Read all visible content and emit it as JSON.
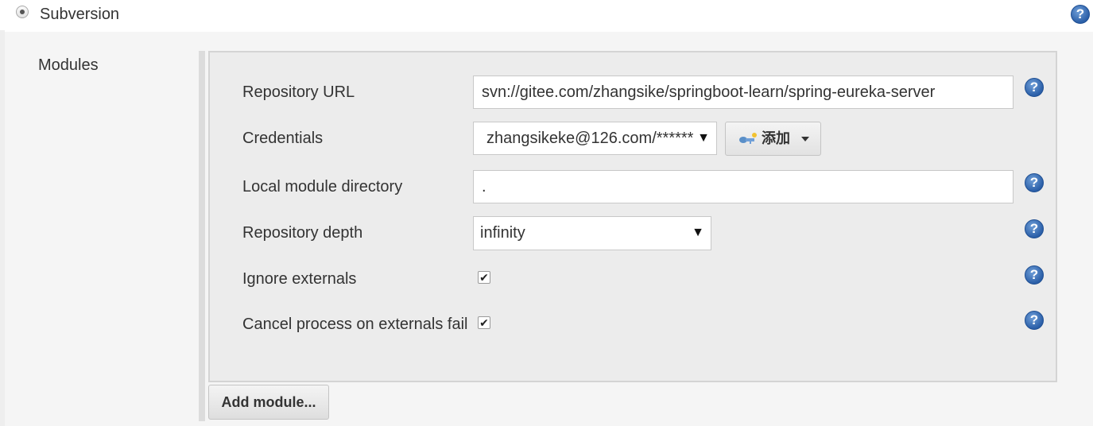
{
  "scm": {
    "option_label": "Subversion",
    "selected": true
  },
  "modules": {
    "section_label": "Modules",
    "repository_url": {
      "label": "Repository URL",
      "value": "svn://gitee.com/zhangsike/springboot-learn/spring-eureka-server"
    },
    "credentials": {
      "label": "Credentials",
      "selected": "zhangsikeke@126.com/******",
      "add_button_label": "添加"
    },
    "local_module_directory": {
      "label": "Local module directory",
      "value": "."
    },
    "repository_depth": {
      "label": "Repository depth",
      "selected": "infinity"
    },
    "ignore_externals": {
      "label": "Ignore externals",
      "checked": true
    },
    "cancel_process_on_externals_fail": {
      "label": "Cancel process on externals fail",
      "checked": true
    },
    "add_module_button_label": "Add module..."
  },
  "help_icon_glyph": "?",
  "check_glyph": "✔",
  "select_arrow_glyph": "▼",
  "colors": {
    "help_icon": "#2b5fa8",
    "panel_background": "#ececec",
    "page_background": "#f5f5f5"
  }
}
